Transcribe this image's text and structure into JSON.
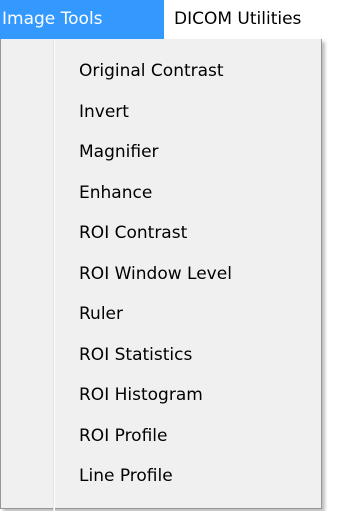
{
  "menubar": {
    "items": [
      {
        "label": "Image Tools",
        "active": true
      },
      {
        "label": "DICOM Utilities",
        "active": false
      }
    ]
  },
  "dropdown": {
    "items": [
      {
        "label": "Original Contrast"
      },
      {
        "label": "Invert"
      },
      {
        "label": "Magnifier"
      },
      {
        "label": "Enhance"
      },
      {
        "label": "ROI Contrast"
      },
      {
        "label": "ROI Window Level"
      },
      {
        "label": "Ruler"
      },
      {
        "label": "ROI Statistics"
      },
      {
        "label": "ROI Histogram"
      },
      {
        "label": "ROI Profile"
      },
      {
        "label": "Line Profile"
      }
    ]
  },
  "colors": {
    "highlight": "#3399ff",
    "menu_background": "#f0f0f0",
    "menu_border": "#979797"
  }
}
